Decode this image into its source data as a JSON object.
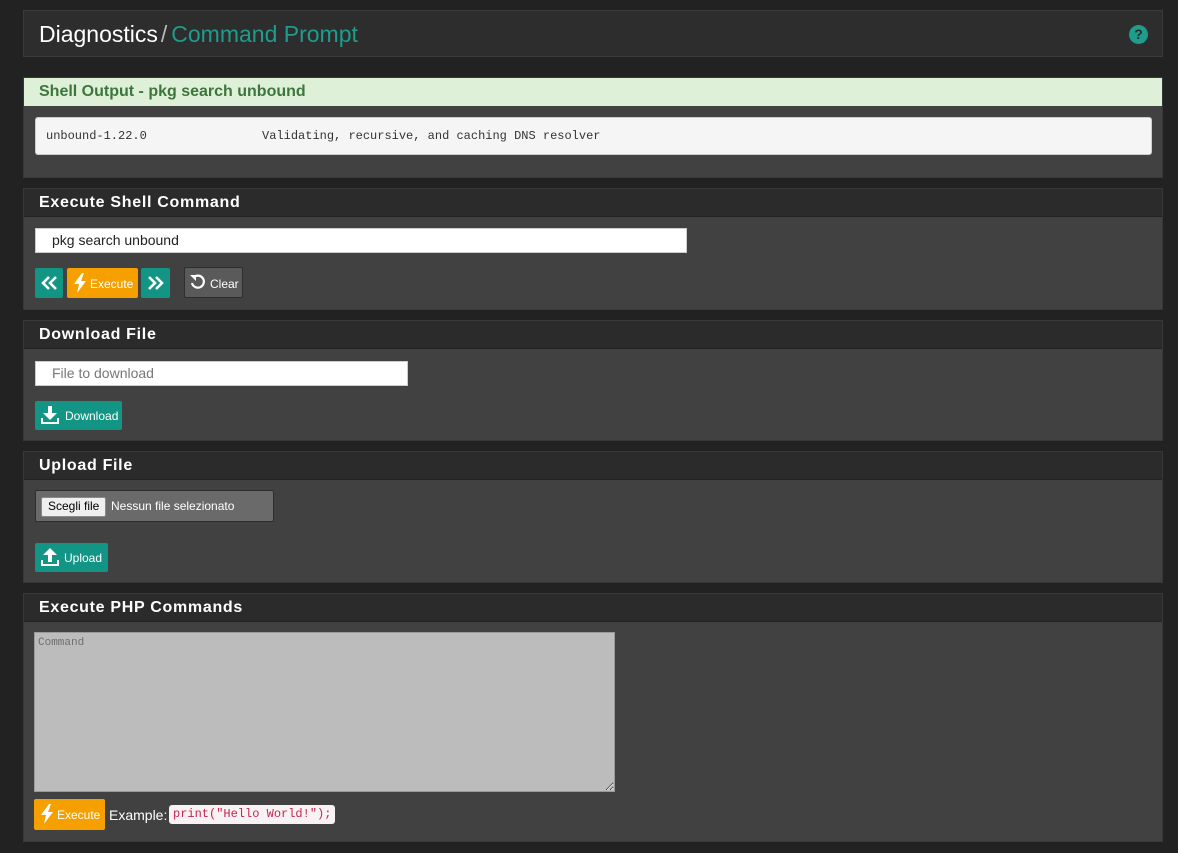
{
  "breadcrumb": {
    "first": "Diagnostics",
    "separator": "/",
    "second": "Command Prompt"
  },
  "help_icon": "question-circle-icon",
  "shell_output": {
    "title": "Shell Output - pkg search unbound",
    "text": "unbound-1.22.0                Validating, recursive, and caching DNS resolver"
  },
  "execute_shell": {
    "title": "Execute Shell Command",
    "command_value": "pkg search unbound",
    "prev_icon": "angle-double-left-icon",
    "execute_label": "Execute",
    "next_icon": "angle-double-right-icon",
    "clear_label": "Clear"
  },
  "download_file": {
    "title": "Download File",
    "placeholder": "File to download",
    "button_label": "Download"
  },
  "upload_file": {
    "title": "Upload File",
    "choose_label": "Scegli file",
    "status": "Nessun file selezionato",
    "button_label": "Upload"
  },
  "php_commands": {
    "title": "Execute PHP Commands",
    "placeholder": "Command",
    "execute_label": "Execute",
    "example_label": "Example:",
    "example_code": "print(\"Hello World!\");"
  },
  "colors": {
    "accent": "#129584",
    "warning": "#f6a000",
    "success_bg": "#dff0d8",
    "success_text": "#3c763d"
  }
}
